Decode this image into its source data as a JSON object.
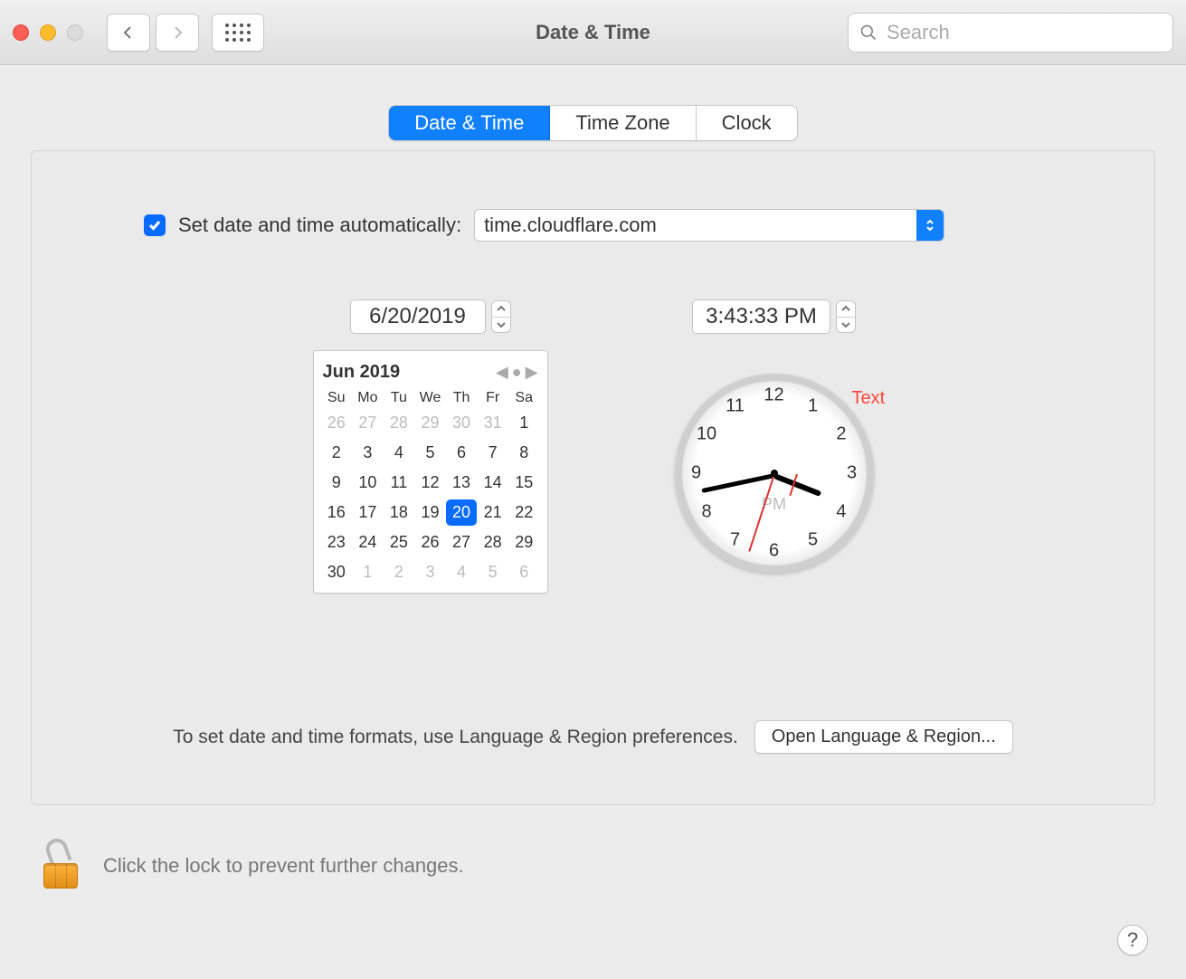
{
  "window": {
    "title": "Date & Time"
  },
  "search": {
    "placeholder": "Search"
  },
  "tabs": {
    "date_time": "Date & Time",
    "time_zone": "Time Zone",
    "clock": "Clock"
  },
  "auto": {
    "label": "Set date and time automatically:",
    "server": "time.cloudflare.com"
  },
  "date_field": "6/20/2019",
  "time_field": "3:43:33 PM",
  "calendar": {
    "month_label": "Jun 2019",
    "dow": [
      "Su",
      "Mo",
      "Tu",
      "We",
      "Th",
      "Fr",
      "Sa"
    ],
    "prev_month": [
      "26",
      "27",
      "28",
      "29",
      "30",
      "31"
    ],
    "days": [
      "1",
      "2",
      "3",
      "4",
      "5",
      "6",
      "7",
      "8",
      "9",
      "10",
      "11",
      "12",
      "13",
      "14",
      "15",
      "16",
      "17",
      "18",
      "19",
      "20",
      "21",
      "22",
      "23",
      "24",
      "25",
      "26",
      "27",
      "28",
      "29",
      "30"
    ],
    "next_month": [
      "1",
      "2",
      "3",
      "4",
      "5",
      "6"
    ],
    "selected": "20"
  },
  "clock": {
    "numbers": [
      "12",
      "1",
      "2",
      "3",
      "4",
      "5",
      "6",
      "7",
      "8",
      "9",
      "10",
      "11"
    ],
    "ampm": "PM",
    "overlay": "Text",
    "hour": 3,
    "minute": 43,
    "second": 33
  },
  "footer": {
    "hint": "To set date and time formats, use Language & Region preferences.",
    "button": "Open Language & Region..."
  },
  "lock": {
    "text": "Click the lock to prevent further changes."
  },
  "help": "?"
}
